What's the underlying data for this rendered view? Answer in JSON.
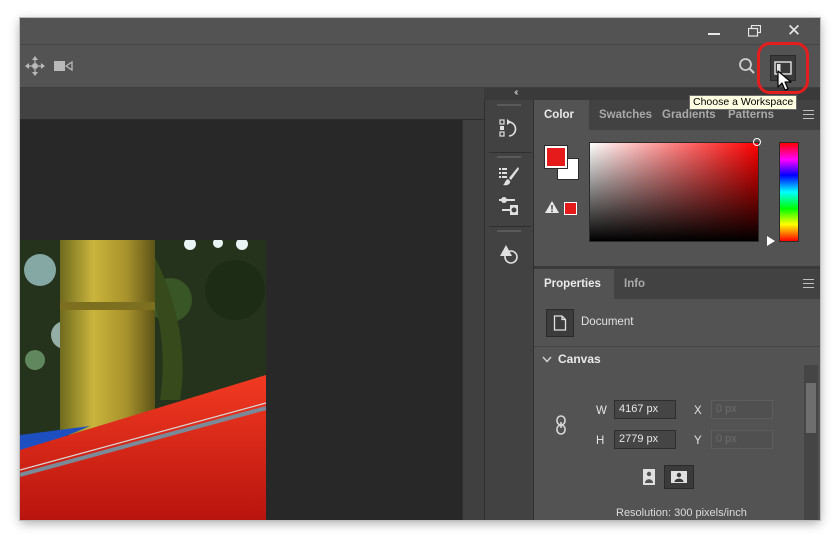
{
  "window": {
    "minimize_icon": "minimize-icon",
    "restore_icon": "restore-icon",
    "close_glyph": "✕"
  },
  "options_bar": {
    "icons": [
      "move-3d-icon",
      "video-camera-icon",
      "search-icon",
      "workspace-icon"
    ]
  },
  "tooltip": {
    "text": "Choose a Workspace"
  },
  "color_panel": {
    "tabs": [
      {
        "label": "Color",
        "active": true
      },
      {
        "label": "Swatches",
        "active": false
      },
      {
        "label": "Gradients",
        "active": false
      },
      {
        "label": "Patterns",
        "active": false
      }
    ],
    "foreground_color": "#e51b1b",
    "background_color": "#ffffff",
    "warning_icon": "gamut-warning-icon"
  },
  "properties_panel": {
    "tabs": [
      {
        "label": "Properties",
        "active": true
      },
      {
        "label": "Info",
        "active": false
      }
    ],
    "document_label": "Document",
    "canvas_section": "Canvas",
    "width_label": "W",
    "width_value": "4167 px",
    "height_label": "H",
    "height_value": "2779 px",
    "x_label": "X",
    "x_placeholder": "0 px",
    "y_label": "Y",
    "y_placeholder": "0 px",
    "resolution": "Resolution: 300 pixels/inch"
  },
  "toolstrip": {
    "icons": [
      "history-icon",
      "brush-presets-icon",
      "adjustments-icon",
      "shapes-icon"
    ]
  },
  "colors": {
    "highlight_ring": "#e41e1e",
    "panel_bg": "#535353",
    "tooltip_bg": "#ffffe1"
  }
}
